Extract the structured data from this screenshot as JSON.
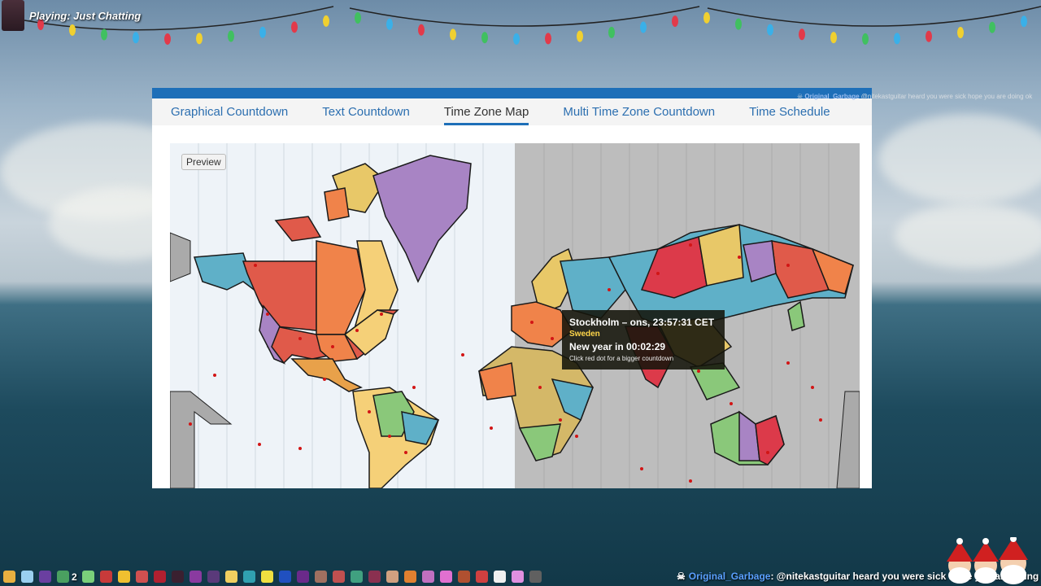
{
  "stream": {
    "status_text": "Playing: Just Chatting"
  },
  "site": {
    "tabs": [
      {
        "label": "Graphical Countdown",
        "active": false
      },
      {
        "label": "Text Countdown",
        "active": false
      },
      {
        "label": "Time Zone Map",
        "active": true
      },
      {
        "label": "Multi Time Zone Countdown",
        "active": false
      },
      {
        "label": "Time Schedule",
        "active": false
      }
    ],
    "preview_label": "Preview",
    "tooltip": {
      "city_line": "Stockholm – ons, 23:57:31 CET",
      "country": "Sweden",
      "countdown": "New year in 00:02:29",
      "hint": "Click red dot for a bigger countdown"
    },
    "colors": {
      "accent": "#1e6fb8",
      "night_shade": "#bdbdbd",
      "day_shade": "#eef3f8"
    }
  },
  "chat": {
    "side_user": "Original_Garbage",
    "side_text": "@nitekastguitar heard you were sick hope you are doing ok",
    "bottom_user": "Original_Garbage",
    "bottom_text": ": @nitekastguitar heard you were sick hope you are doing ok",
    "emote_count": "2"
  }
}
